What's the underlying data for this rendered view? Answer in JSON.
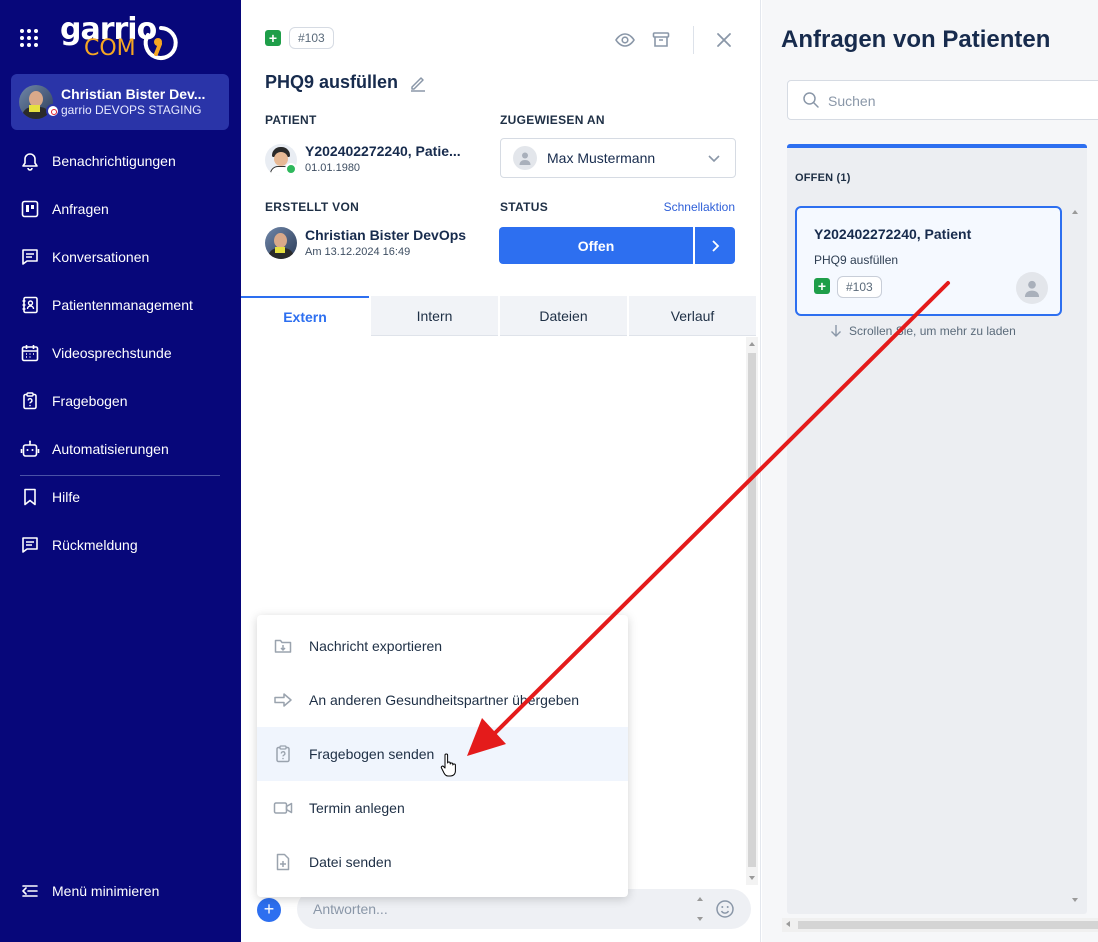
{
  "sidebar": {
    "logo": {
      "top": "garrio",
      "bottom": "COM"
    },
    "user": {
      "name": "Christian Bister Dev...",
      "org": "garrio DEVOPS STAGING"
    },
    "nav": [
      {
        "label": "Benachrichtigungen",
        "icon": "bell-icon"
      },
      {
        "label": "Anfragen",
        "icon": "board-icon"
      },
      {
        "label": "Konversationen",
        "icon": "chat-icon"
      },
      {
        "label": "Patientenmanagement",
        "icon": "contact-book-icon"
      },
      {
        "label": "Videosprechstunde",
        "icon": "calendar-icon"
      },
      {
        "label": "Fragebogen",
        "icon": "clipboard-question-icon"
      },
      {
        "label": "Automatisierungen",
        "icon": "robot-icon"
      }
    ],
    "nav2": [
      {
        "label": "Hilfe",
        "icon": "bookmark-icon"
      },
      {
        "label": "Rückmeldung",
        "icon": "feedback-icon"
      }
    ],
    "collapse_label": "Menü minimieren"
  },
  "detail": {
    "id_badge": "#103",
    "title": "PHQ9 ausfüllen",
    "patient_label": "PATIENT",
    "patient_name": "Y202402272240, Patie...",
    "patient_dob": "01.01.1980",
    "assigned_label": "ZUGEWIESEN AN",
    "assignee": "Max Mustermann",
    "created_by_label": "ERSTELLT VON",
    "creator_name": "Christian Bister DevOps",
    "creator_date": "Am 13.12.2024 16:49",
    "status_label": "STATUS",
    "quick_action": "Schnellaktion",
    "status_value": "Offen",
    "tabs": [
      {
        "label": "Extern"
      },
      {
        "label": "Intern"
      },
      {
        "label": "Dateien"
      },
      {
        "label": "Verlauf"
      }
    ],
    "reply_placeholder": "Antworten..."
  },
  "menu": {
    "items": [
      {
        "label": "Nachricht exportieren",
        "icon": "folder-download-icon"
      },
      {
        "label": "An anderen Gesundheitspartner übergeben",
        "icon": "arrow-right-icon"
      },
      {
        "label": "Fragebogen senden",
        "icon": "clipboard-question-icon"
      },
      {
        "label": "Termin anlegen",
        "icon": "video-camera-icon"
      },
      {
        "label": "Datei senden",
        "icon": "file-plus-icon"
      }
    ],
    "highlighted_item": "Fragebogen senden"
  },
  "requests": {
    "title": "Anfragen von Patienten",
    "search_placeholder": "Suchen",
    "column_title": "OFFEN (1)",
    "card": {
      "title": "Y202402272240, Patient",
      "subtitle": "PHQ9 ausfüllen",
      "id": "#103"
    },
    "load_more": "Scrollen Sie, um mehr zu laden"
  },
  "colors": {
    "sidebar_bg": "#07077a",
    "primary": "#2d6ff0",
    "success": "#1e9e49",
    "logo_accent": "#f5a623",
    "annotation_arrow": "#e41b1b"
  }
}
